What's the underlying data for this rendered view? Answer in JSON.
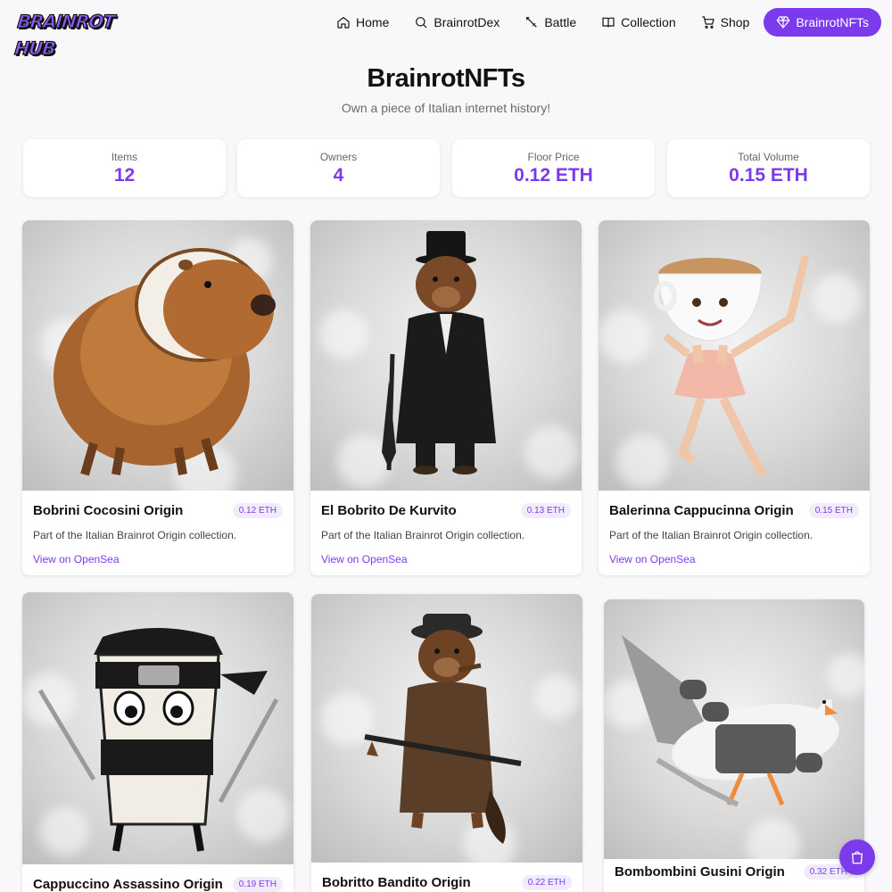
{
  "brand": {
    "logo_text": "BRAINROT HUB"
  },
  "nav": [
    {
      "label": "Home",
      "icon": "home-icon"
    },
    {
      "label": "BrainrotDex",
      "icon": "search-icon"
    },
    {
      "label": "Battle",
      "icon": "sword-icon"
    },
    {
      "label": "Collection",
      "icon": "book-icon"
    },
    {
      "label": "Shop",
      "icon": "cart-icon"
    },
    {
      "label": "BrainrotNFTs",
      "icon": "diamond-icon",
      "active": true
    }
  ],
  "header": {
    "title": "BrainrotNFTs",
    "subtitle": "Own a piece of Italian internet history!"
  },
  "stats": [
    {
      "label": "Items",
      "value": "12"
    },
    {
      "label": "Owners",
      "value": "4"
    },
    {
      "label": "Floor Price",
      "value": "0.12 ETH"
    },
    {
      "label": "Total Volume",
      "value": "0.15 ETH"
    }
  ],
  "cards": [
    {
      "name": "Bobrini Cocosini Origin",
      "price": "0.12 ETH",
      "desc": "Part of the Italian Brainrot Origin collection.",
      "link": "View on OpenSea",
      "image": "capybara-coconut-image"
    },
    {
      "name": "El Bobrito De Kurvito",
      "price": "0.13 ETH",
      "desc": "Part of the Italian Brainrot Origin collection.",
      "link": "View on OpenSea",
      "image": "beaver-top-hat-image"
    },
    {
      "name": "Balerinna Cappucinna Origin",
      "price": "0.15 ETH",
      "desc": "Part of the Italian Brainrot Origin collection.",
      "link": "View on OpenSea",
      "image": "cappuccino-ballerina-image"
    },
    {
      "name": "Cappuccino Assassino Origin",
      "price": "0.19 ETH",
      "image": "ninja-coffee-cup-image"
    },
    {
      "name": "Bobritto Bandito Origin",
      "price": "0.22 ETH",
      "image": "beaver-gangster-image"
    },
    {
      "name": "Bombombini Gusini Origin",
      "price": "0.32 ETH",
      "image": "jet-goose-image"
    }
  ],
  "colors": {
    "accent": "#7c3aed",
    "background": "#f8f8fa"
  },
  "fab": {
    "icon": "shopping-bag-icon"
  }
}
